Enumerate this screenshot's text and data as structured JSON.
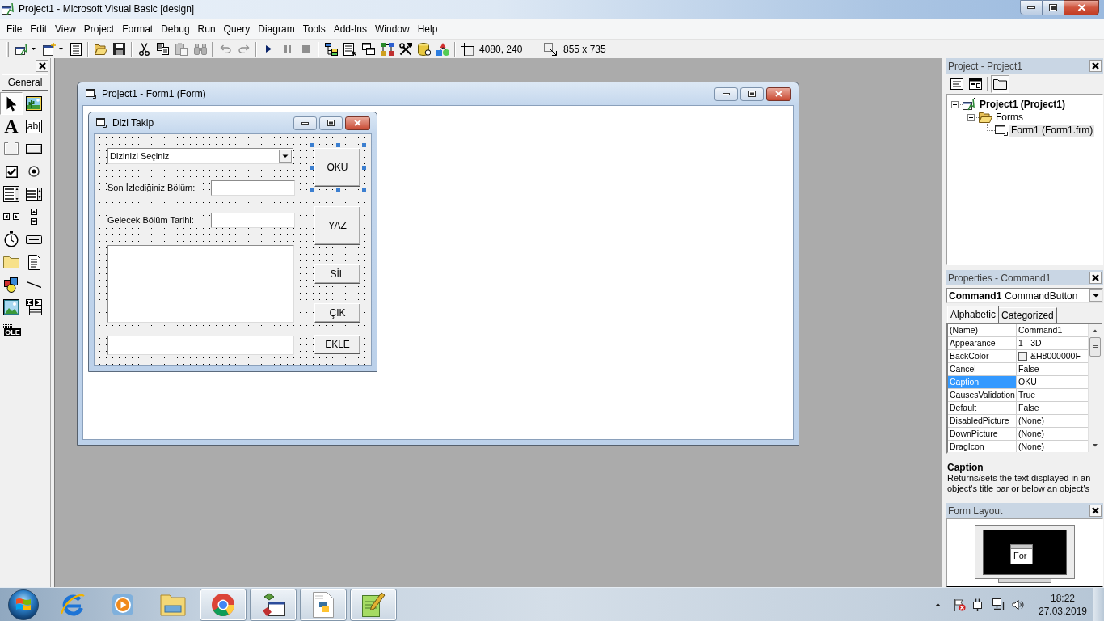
{
  "window": {
    "title": "Project1 - Microsoft Visual Basic [design]"
  },
  "menu": [
    {
      "label": "File"
    },
    {
      "label": "Edit"
    },
    {
      "label": "View"
    },
    {
      "label": "Project"
    },
    {
      "label": "Format"
    },
    {
      "label": "Debug"
    },
    {
      "label": "Run"
    },
    {
      "label": "Query"
    },
    {
      "label": "Diagram"
    },
    {
      "label": "Tools"
    },
    {
      "label": "Add-Ins"
    },
    {
      "label": "Window"
    },
    {
      "label": "Help"
    }
  ],
  "toolbar": {
    "items": [
      {
        "kind": "add-project",
        "dropdown": true,
        "disabled": false
      },
      {
        "kind": "add-form",
        "dropdown": true,
        "disabled": false
      },
      {
        "kind": "menu-editor",
        "dropdown": false,
        "disabled": false
      },
      {
        "kind": "separator"
      },
      {
        "kind": "open",
        "dropdown": false,
        "disabled": false
      },
      {
        "kind": "save",
        "dropdown": false,
        "disabled": false
      },
      {
        "kind": "separator"
      },
      {
        "kind": "cut",
        "dropdown": false,
        "disabled": false
      },
      {
        "kind": "copy",
        "dropdown": false,
        "disabled": false
      },
      {
        "kind": "paste",
        "dropdown": false,
        "disabled": true
      },
      {
        "kind": "find",
        "dropdown": false,
        "disabled": true
      },
      {
        "kind": "separator"
      },
      {
        "kind": "undo",
        "dropdown": false,
        "disabled": true
      },
      {
        "kind": "redo",
        "dropdown": false,
        "disabled": true
      },
      {
        "kind": "separator"
      },
      {
        "kind": "run",
        "dropdown": false,
        "disabled": false
      },
      {
        "kind": "break",
        "dropdown": false,
        "disabled": true
      },
      {
        "kind": "end",
        "dropdown": false,
        "disabled": true
      },
      {
        "kind": "separator"
      },
      {
        "kind": "project-explorer",
        "dropdown": false,
        "disabled": false
      },
      {
        "kind": "properties",
        "dropdown": false,
        "disabled": false
      },
      {
        "kind": "form-layout",
        "dropdown": false,
        "disabled": false
      },
      {
        "kind": "object-browser",
        "dropdown": false,
        "disabled": false
      },
      {
        "kind": "toolbox",
        "dropdown": false,
        "disabled": false
      },
      {
        "kind": "data-view",
        "dropdown": false,
        "disabled": false
      },
      {
        "kind": "component-manager",
        "dropdown": false,
        "disabled": false
      },
      {
        "kind": "separator"
      }
    ],
    "position": "4080, 240",
    "size": "855 x 735"
  },
  "toolbox": {
    "tab": "General",
    "tools": [
      {
        "kind": "pointer",
        "selected": true
      },
      {
        "kind": "picture",
        "selected": false
      },
      {
        "kind": "label",
        "glyph": "A",
        "selected": false
      },
      {
        "kind": "textbox",
        "glyph": "ab|",
        "selected": false
      },
      {
        "kind": "frame",
        "selected": false
      },
      {
        "kind": "command",
        "selected": false
      },
      {
        "kind": "checkbox",
        "selected": false
      },
      {
        "kind": "option",
        "selected": false
      },
      {
        "kind": "combo",
        "selected": false
      },
      {
        "kind": "list",
        "selected": false
      },
      {
        "kind": "hscroll",
        "selected": false
      },
      {
        "kind": "vscroll",
        "selected": false
      },
      {
        "kind": "timer",
        "selected": false
      },
      {
        "kind": "drive",
        "selected": false
      },
      {
        "kind": "dir",
        "selected": false
      },
      {
        "kind": "file",
        "selected": false
      },
      {
        "kind": "shape",
        "selected": false
      },
      {
        "kind": "line",
        "selected": false
      },
      {
        "kind": "image",
        "selected": false
      },
      {
        "kind": "data",
        "selected": false
      },
      {
        "kind": "ole",
        "glyph": "OLE",
        "selected": false
      }
    ]
  },
  "designer": {
    "title": "Project1 - Form1 (Form)",
    "form": {
      "title": "Dizi Takip",
      "controls": [
        {
          "kind": "combo",
          "text": "Dizinizi Seçiniz",
          "selected": false
        },
        {
          "kind": "label",
          "text": "Son İzlediğiniz Bölüm:",
          "selected": false
        },
        {
          "kind": "textbox",
          "selected": false
        },
        {
          "kind": "label",
          "text": "Gelecek Bölüm Tarihi:",
          "selected": false
        },
        {
          "kind": "textbox",
          "selected": false
        },
        {
          "kind": "listbox",
          "selected": false
        },
        {
          "kind": "textbox",
          "selected": false
        },
        {
          "kind": "button",
          "text": "OKU",
          "selected": true
        },
        {
          "kind": "button",
          "text": "YAZ",
          "selected": false
        },
        {
          "kind": "button",
          "text": "SİL",
          "selected": false
        },
        {
          "kind": "button",
          "text": "ÇIK",
          "selected": false
        },
        {
          "kind": "button",
          "text": "EKLE",
          "selected": false
        }
      ]
    }
  },
  "project": {
    "title": "Project - Project1",
    "toolbar": [
      {
        "kind": "view-code",
        "pressed": false
      },
      {
        "kind": "view-object",
        "pressed": false
      },
      {
        "kind": "toggle-folders",
        "pressed": true
      }
    ],
    "tree": [
      {
        "kind": "project",
        "label": "Project1 (Project1)",
        "expanded": true,
        "selected": false,
        "children": [
          {
            "kind": "folder",
            "label": "Forms",
            "expanded": true,
            "selected": false,
            "children": [
              {
                "kind": "form",
                "label": "Form1 (Form1.frm)",
                "selected": true
              }
            ]
          }
        ]
      }
    ]
  },
  "properties": {
    "title": "Properties - Command1",
    "object": {
      "name": "Command1",
      "type": "CommandButton"
    },
    "tabs": [
      {
        "label": "Alphabetic",
        "selected": true
      },
      {
        "label": "Categorized",
        "selected": false
      }
    ],
    "rows": [
      {
        "name": "(Name)",
        "value": "Command1",
        "selected": false
      },
      {
        "name": "Appearance",
        "value": "1 - 3D",
        "selected": false
      },
      {
        "name": "BackColor",
        "value": "&H8000000F",
        "color": "#f0f0f0",
        "selected": false
      },
      {
        "name": "Cancel",
        "value": "False",
        "selected": false
      },
      {
        "name": "Caption",
        "value": "OKU",
        "selected": true
      },
      {
        "name": "CausesValidation",
        "value": "True",
        "selected": false
      },
      {
        "name": "Default",
        "value": "False",
        "selected": false
      },
      {
        "name": "DisabledPicture",
        "value": "(None)",
        "selected": false
      },
      {
        "name": "DownPicture",
        "value": "(None)",
        "selected": false
      },
      {
        "name": "DragIcon",
        "value": "(None)",
        "selected": false
      }
    ],
    "description": {
      "title": "Caption",
      "text": "Returns/sets the text displayed in an object's title bar or below an object's"
    }
  },
  "form_layout": {
    "title": "Form Layout",
    "form_label": "For"
  },
  "taskbar": {
    "apps": [
      {
        "kind": "internet-explorer",
        "running": false
      },
      {
        "kind": "media-player",
        "running": false
      },
      {
        "kind": "explorer",
        "running": false
      },
      {
        "kind": "chrome",
        "running": true
      },
      {
        "kind": "visual-basic",
        "running": true
      },
      {
        "kind": "python",
        "running": true
      },
      {
        "kind": "notepad-plus",
        "running": true
      }
    ],
    "time": "18:22",
    "date": "27.03.2019"
  }
}
